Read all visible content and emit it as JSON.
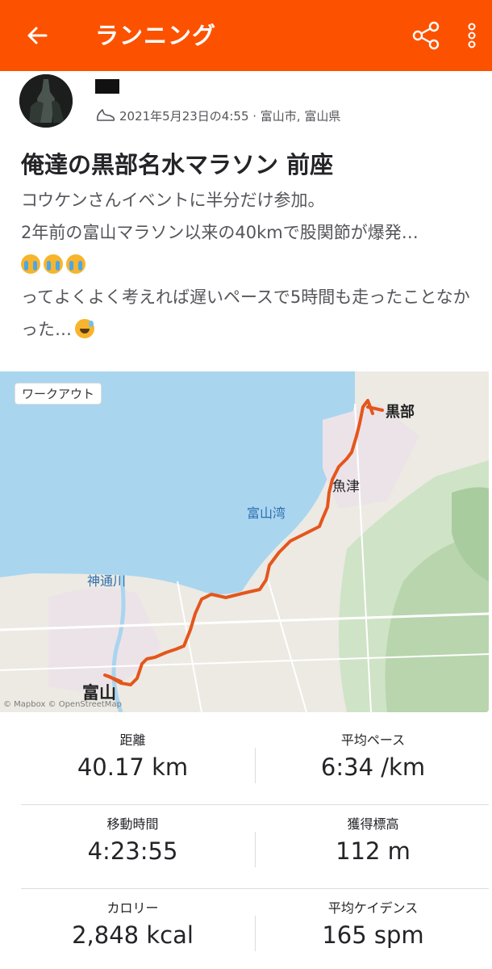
{
  "header": {
    "title": "ランニング",
    "back_icon": "back-arrow-icon",
    "share_icon": "share-icon",
    "more_icon": "more-vertical-icon",
    "bar_color": "#fc5200"
  },
  "activity": {
    "meta": "2021年5月23日の4:55 · 富山市, 富山県",
    "title": "俺達の黒部名水マラソン 前座",
    "description": {
      "line1": "コウケンさんイベントに半分だけ参加。",
      "line2": "2年前の富山マラソン以来の40kmで股関節が爆発…",
      "line3": "ってよくよく考えれば遅いペースで5時間も走ったことなかった…"
    }
  },
  "map": {
    "chip": "ワークアウト",
    "labels": {
      "kurobe": "黒部",
      "uozu": "魚津",
      "toyama_bay": "富山湾",
      "jinzu": "神通川",
      "toyama": "富山"
    },
    "attribution": "© Mapbox © OpenStreetMap",
    "route_color": "#e4561c"
  },
  "stats": [
    {
      "label": "距離",
      "value": "40.17 km"
    },
    {
      "label": "平均ペース",
      "value": "6:34 /km"
    },
    {
      "label": "移動時間",
      "value": "4:23:55"
    },
    {
      "label": "獲得標高",
      "value": "112 m"
    },
    {
      "label": "カロリー",
      "value": "2,848 kcal"
    },
    {
      "label": "平均ケイデンス",
      "value": "165 spm"
    }
  ]
}
